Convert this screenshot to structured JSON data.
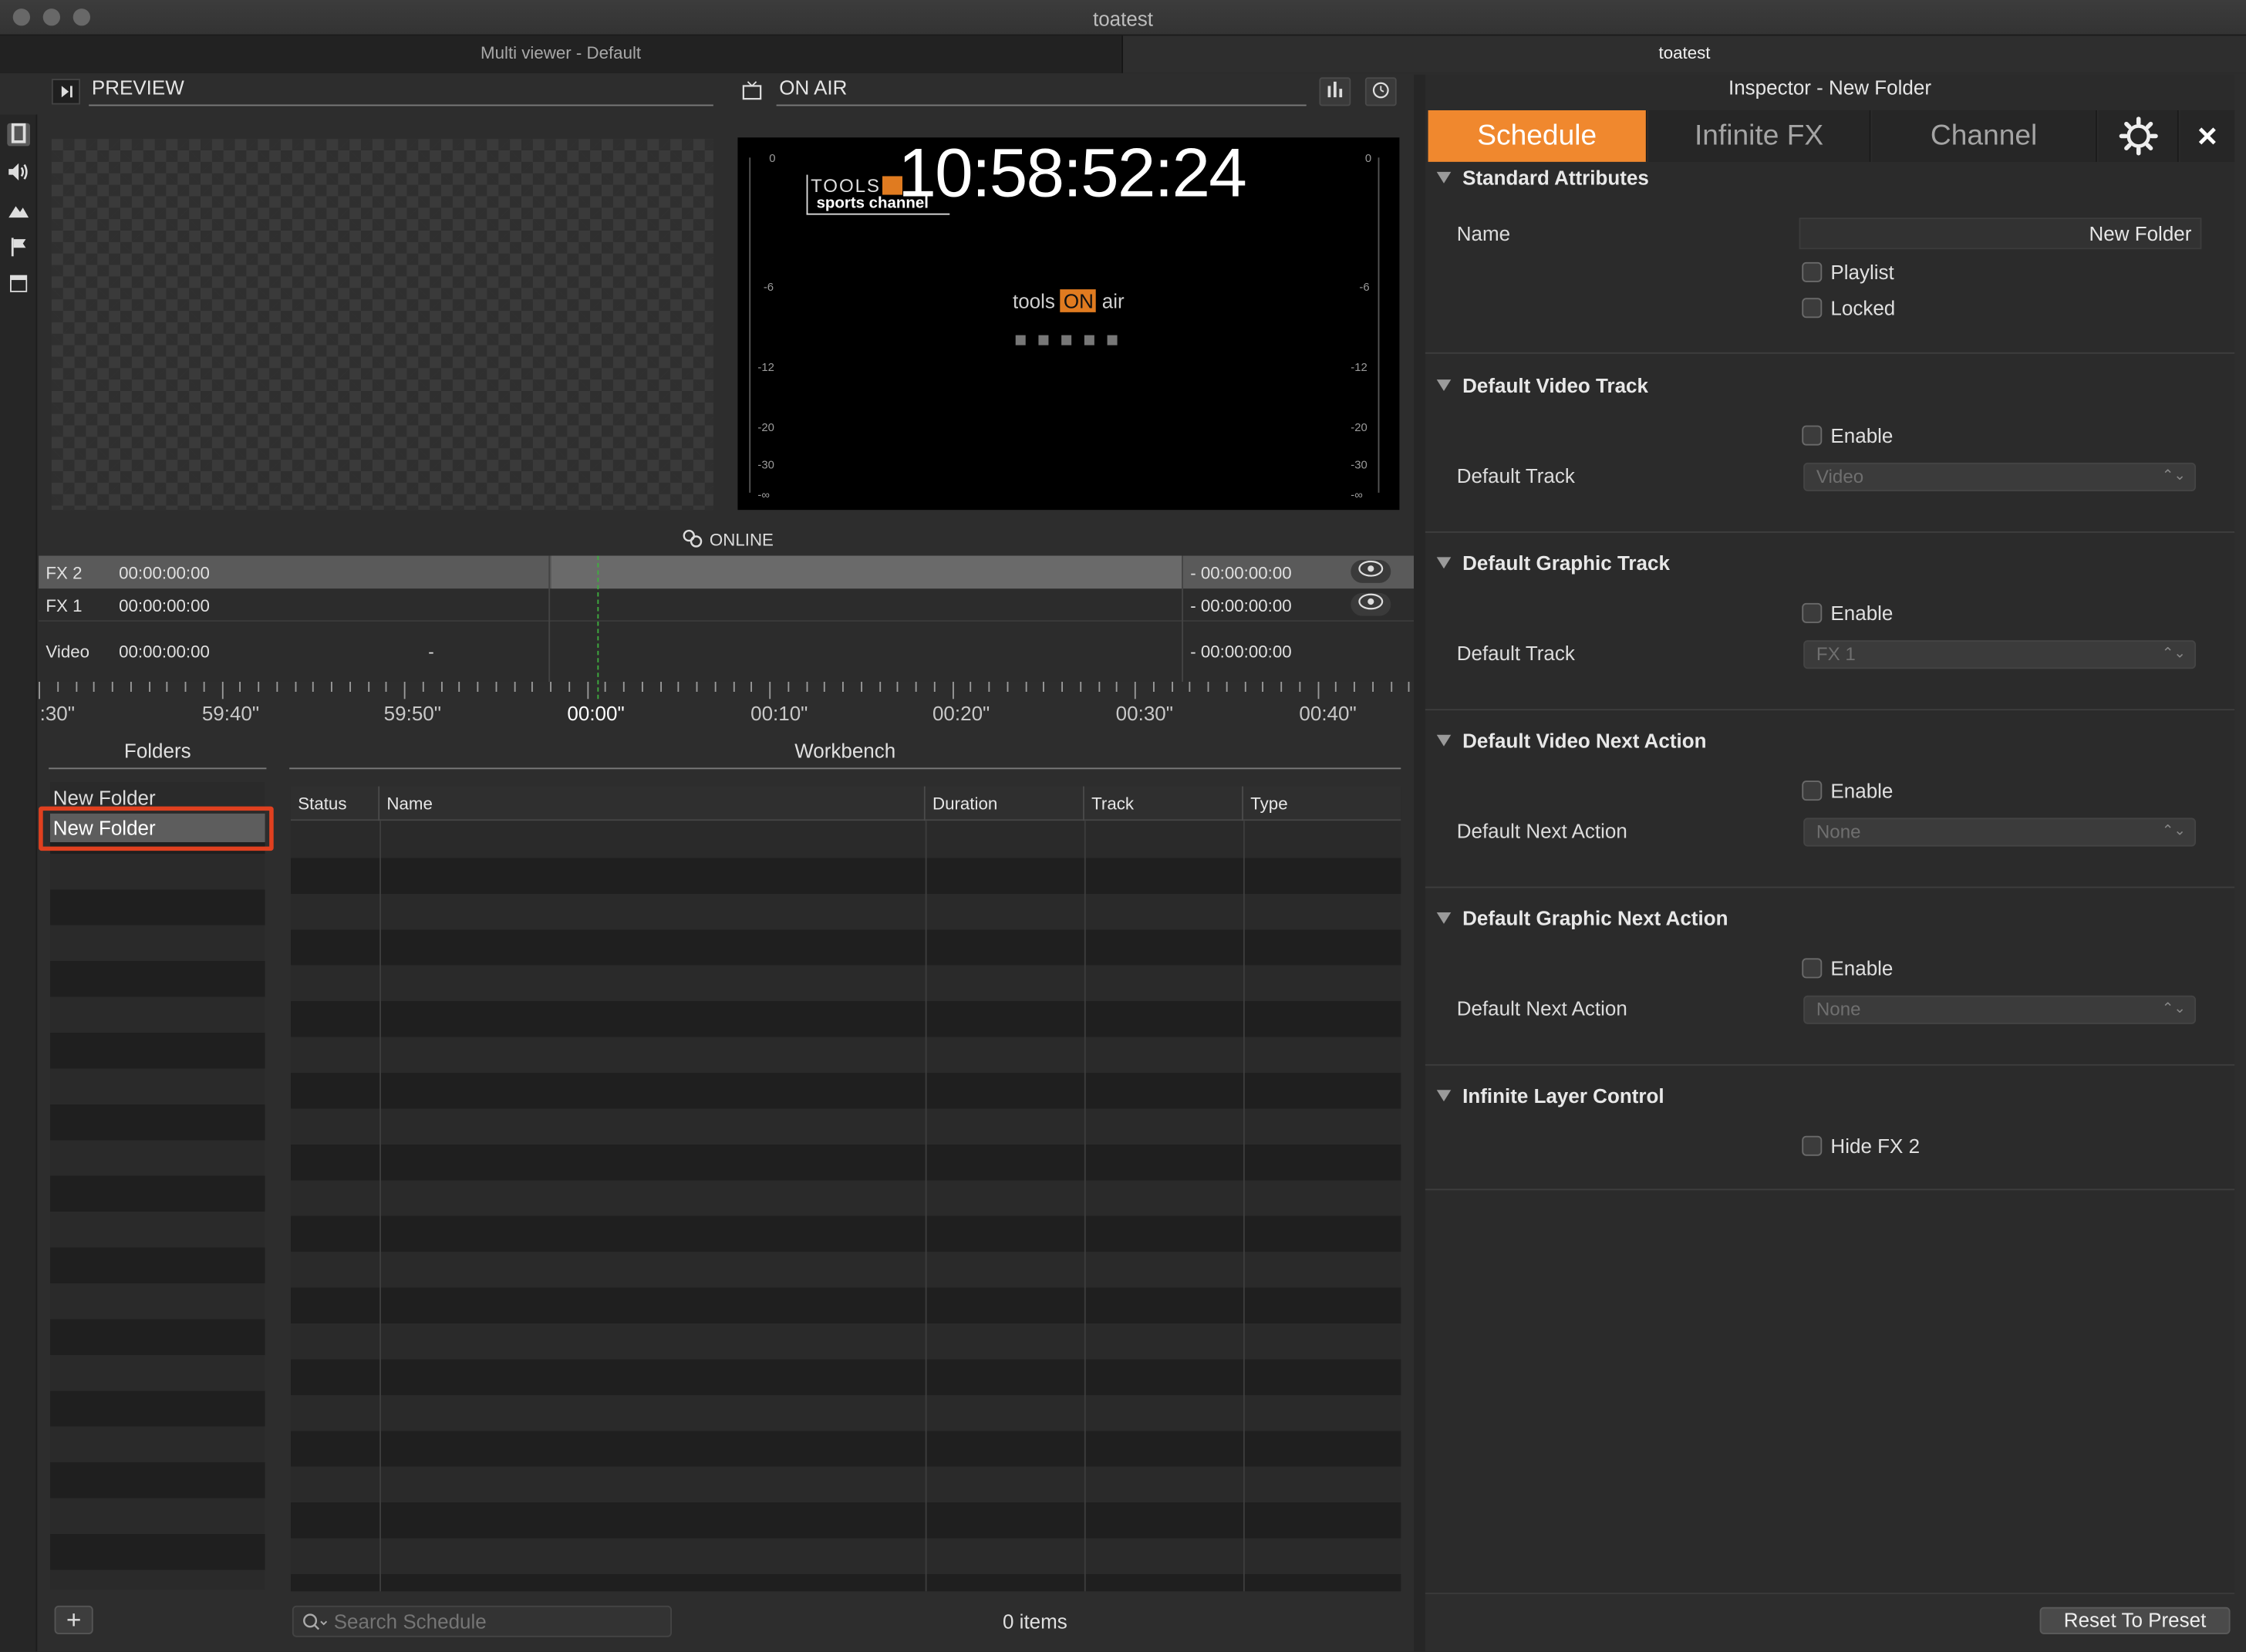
{
  "window": {
    "title": "toatest"
  },
  "tabs": [
    {
      "label": "Multi viewer - Default"
    },
    {
      "label": "toatest"
    }
  ],
  "preview": {
    "label": "PREVIEW"
  },
  "onair": {
    "label": "ON AIR",
    "clock": "10:58:52:24",
    "overlay_brand": "TOOLS",
    "overlay_channel": "sports channel",
    "logo_a": "tools",
    "logo_b": "ON",
    "logo_c": "air",
    "status": "ONLINE",
    "meter_ticks": [
      "0",
      "-6",
      "-12",
      "-20",
      "-30",
      "-∞"
    ]
  },
  "timeline": {
    "tracks": [
      {
        "name": "FX 2",
        "start": "00:00:00:00",
        "mid": "",
        "end": "- 00:00:00:00"
      },
      {
        "name": "FX 1",
        "start": "00:00:00:00",
        "mid": "",
        "end": "- 00:00:00:00"
      },
      {
        "name": "Video",
        "start": "00:00:00:00",
        "mid": "-",
        "end": "- 00:00:00:00"
      }
    ],
    "ruler": [
      ":30\"",
      "59:40\"",
      "59:50\"",
      "00:00\"",
      "00:10\"",
      "00:20\"",
      "00:30\"",
      "00:40\""
    ]
  },
  "folders": {
    "title": "Folders",
    "items": [
      "New Folder",
      "New Folder"
    ],
    "add_label": "+"
  },
  "workbench": {
    "title": "Workbench",
    "columns": [
      "Status",
      "Name",
      "Duration",
      "Track",
      "Type"
    ],
    "search_placeholder": "Search Schedule",
    "count": "0 items"
  },
  "inspector": {
    "title": "Inspector - New Folder",
    "tabs": [
      "Schedule",
      "Infinite FX",
      "Channel"
    ],
    "accent": "#f0882e",
    "standard": {
      "title": "Standard Attributes",
      "name_label": "Name",
      "name_value": "New Folder",
      "playlist": "Playlist",
      "locked": "Locked"
    },
    "video_track": {
      "title": "Default Video Track",
      "enable": "Enable",
      "label": "Default Track",
      "value": "Video"
    },
    "graphic_track": {
      "title": "Default Graphic Track",
      "enable": "Enable",
      "label": "Default Track",
      "value": "FX 1"
    },
    "video_next": {
      "title": "Default Video Next Action",
      "enable": "Enable",
      "label": "Default Next Action",
      "value": "None"
    },
    "graphic_next": {
      "title": "Default Graphic Next Action",
      "enable": "Enable",
      "label": "Default Next Action",
      "value": "None"
    },
    "infinite": {
      "title": "Infinite Layer Control",
      "hide": "Hide FX 2"
    },
    "reset_label": "Reset To Preset"
  }
}
